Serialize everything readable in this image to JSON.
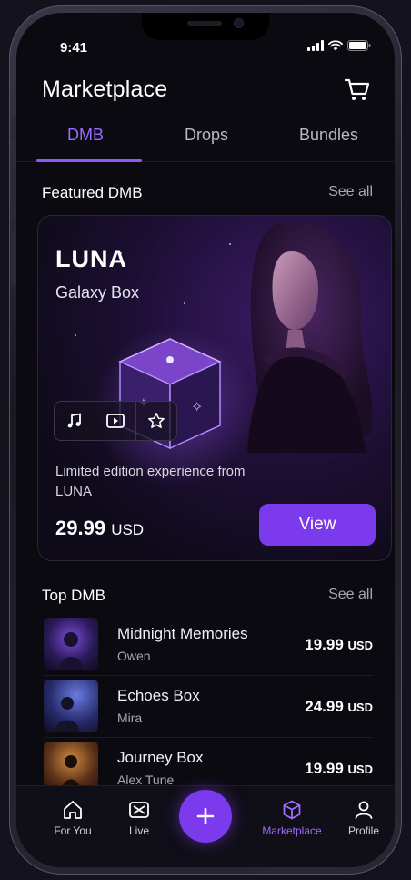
{
  "status_bar": {
    "time": "9:41"
  },
  "header": {
    "title": "Marketplace"
  },
  "tabs": [
    {
      "label": "DMB",
      "active": true
    },
    {
      "label": "Drops",
      "active": false
    },
    {
      "label": "Bundles",
      "active": false
    }
  ],
  "featured": {
    "section_title": "Featured DMB",
    "see_all": "See all",
    "artist": "LUNA",
    "box_name": "Galaxy Box",
    "description": "Limited edition experience from LUNA",
    "price": "29.99",
    "currency": "USD",
    "view_label": "View",
    "media_icons": [
      "music-note-icon",
      "play-icon",
      "star-icon"
    ]
  },
  "top": {
    "section_title": "Top DMB",
    "see_all": "See all",
    "items": [
      {
        "title": "Midnight Memories",
        "artist": "Owen",
        "price": "19.99",
        "currency": "USD"
      },
      {
        "title": "Echoes Box",
        "artist": "Mira",
        "price": "24.99",
        "currency": "USD"
      },
      {
        "title": "Journey Box",
        "artist": "Alex Tune",
        "price": "19.99",
        "currency": "USD"
      }
    ]
  },
  "nav": [
    {
      "label": "For You",
      "icon": "home-icon"
    },
    {
      "label": "Live",
      "icon": "live-icon"
    },
    {
      "label": "",
      "icon": "plus-icon"
    },
    {
      "label": "Marketplace",
      "icon": "cube-icon",
      "active": true
    },
    {
      "label": "Profile",
      "icon": "user-icon"
    }
  ],
  "colors": {
    "accent": "#7c3aed",
    "accent_text": "#9b6bff",
    "background": "#0b0a10"
  }
}
